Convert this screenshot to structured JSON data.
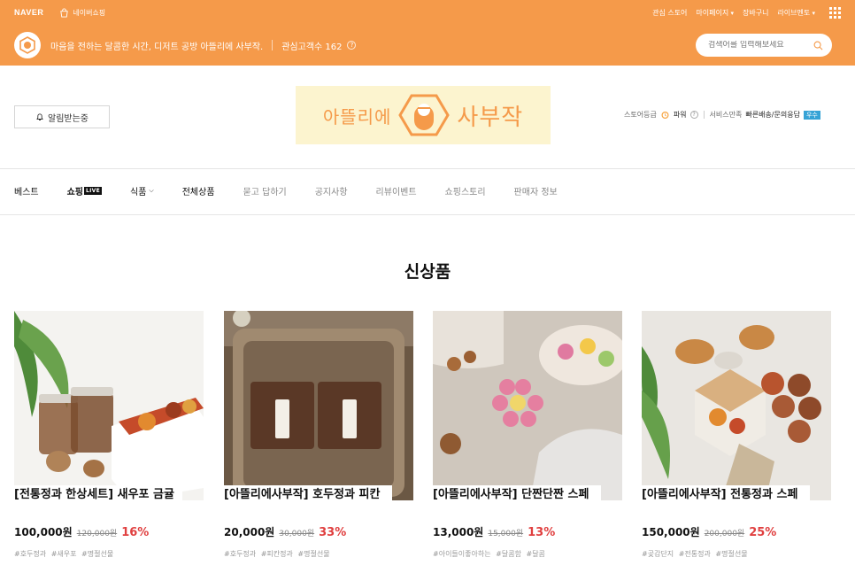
{
  "topbar": {
    "brand": "NAVER",
    "naver_shopping": "네이버쇼핑",
    "links": [
      "관심 스토어",
      "마이페이지",
      "장바구니",
      "라이브멘토"
    ]
  },
  "store": {
    "description": "마음을 전하는 달콤한 시간, 디저트 공방 아뜰리에 사부작.",
    "fav_label": "관심고객수 162",
    "search_placeholder": "검색어를 입력해보세요"
  },
  "header": {
    "alarm_label": "알림받는중",
    "logo_text_1": "아뜰리에",
    "logo_text_2": "사부작",
    "grade_label": "스토어등급",
    "grade_value": "파워",
    "service_label": "서비스만족",
    "service_value": "빠른배송/문의응답",
    "service_badge": "우수"
  },
  "nav": {
    "items": [
      "베스트",
      "쇼핑",
      "식품",
      "전체상품",
      "묻고 답하기",
      "공지사항",
      "리뷰이벤트",
      "쇼핑스토리",
      "판매자 정보"
    ],
    "live_badge": "LIVE"
  },
  "section": {
    "title": "신상품"
  },
  "products": [
    {
      "name": "[전통정과 한상세트] 새우포 금귤정과 올리브정과 호두...",
      "price": "100,000원",
      "original_price": "120,000원",
      "discount": "16%",
      "tags": [
        "#호두정과",
        "#새우포",
        "#명절선물"
      ]
    },
    {
      "name": "[아뜰리에사부작] 호두정과 피칸정과 답례품 추석선물 ...",
      "price": "20,000원",
      "original_price": "30,000원",
      "discount": "33%",
      "tags": [
        "#호두정과",
        "#피칸정과",
        "#명절선물"
      ]
    },
    {
      "name": "[아뜰리에사부작] 단짠단짠 스페셜 프레첼 도토리몬드 ...",
      "price": "13,000원",
      "original_price": "15,000원",
      "discount": "13%",
      "tags": [
        "#아이들이좋아하는",
        "#달콤함",
        "#달콤"
      ]
    },
    {
      "name": "[아뜰리에사부작] 전통정과 스페셜 선물세트",
      "price": "150,000원",
      "original_price": "200,000원",
      "discount": "25%",
      "tags": [
        "#곶감단지",
        "#전통정과",
        "#명절선물"
      ]
    }
  ],
  "colors": {
    "brand_orange": "#f59a4a",
    "discount_red": "#e04040",
    "badge_blue": "#36a3d6"
  }
}
